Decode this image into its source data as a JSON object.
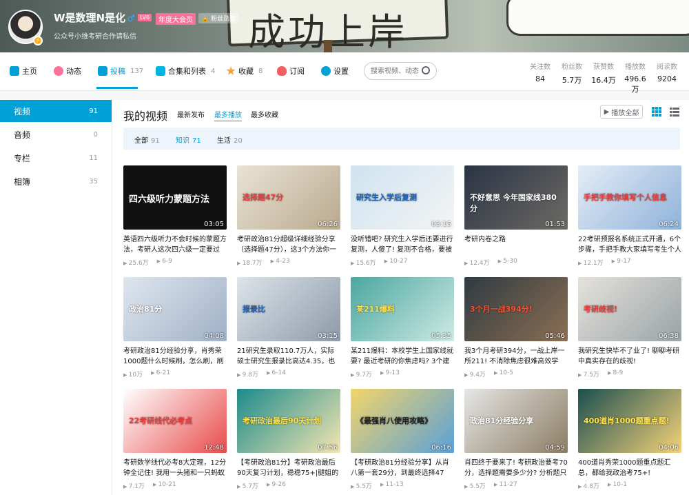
{
  "profile": {
    "username": "W是数理N是化",
    "gender_symbol": "♂",
    "level": "LV6",
    "vip_label": "年度大会员",
    "medal_label": "粉丝勋章",
    "signature": "公众号小维考研合作请私信",
    "banner_text": "成功上岸"
  },
  "nav": {
    "items": [
      {
        "label": "主页",
        "count": ""
      },
      {
        "label": "动态",
        "count": ""
      },
      {
        "label": "投稿",
        "count": "137"
      },
      {
        "label": "合集和列表",
        "count": "4"
      },
      {
        "label": "收藏",
        "count": "8"
      },
      {
        "label": "订阅",
        "count": ""
      },
      {
        "label": "设置",
        "count": ""
      }
    ],
    "search_placeholder": "搜索视频、动态"
  },
  "stats": [
    {
      "label": "关注数",
      "value": "84"
    },
    {
      "label": "粉丝数",
      "value": "5.7万"
    },
    {
      "label": "获赞数",
      "value": "16.4万"
    },
    {
      "label": "播放数",
      "value": "496.6万"
    },
    {
      "label": "阅读数",
      "value": "9204"
    }
  ],
  "sidebar": [
    {
      "label": "视频",
      "count": "91"
    },
    {
      "label": "音频",
      "count": "0"
    },
    {
      "label": "专栏",
      "count": "11"
    },
    {
      "label": "相簿",
      "count": "35"
    }
  ],
  "main": {
    "title": "我的视频",
    "sort_tabs": [
      "最新发布",
      "最多播放",
      "最多收藏"
    ],
    "play_all": "播放全部",
    "filters": [
      {
        "label": "全部",
        "count": "91"
      },
      {
        "label": "知识",
        "count": "71"
      },
      {
        "label": "生活",
        "count": "20"
      }
    ]
  },
  "videos": [
    {
      "title": "英语四六级听力不会时候的蒙题方法，考研人这次四六级一定要过",
      "duration": "03:05",
      "plays": "25.6万",
      "date": "6-9",
      "thumb_text": "四六级听力蒙题方法"
    },
    {
      "title": "考研政治81分超级详细经验分享（选择题47分），这3个方法你一定",
      "duration": "06:26",
      "plays": "18.7万",
      "date": "4-23",
      "thumb_text": "选择题47分"
    },
    {
      "title": "没听错吧? 研究生入学后还要进行复测，人傻了! 复测不合格，要被",
      "duration": "03:15",
      "plays": "15.6万",
      "date": "10-27",
      "thumb_text": "研究生入学后复测"
    },
    {
      "title": "考研内卷之路",
      "duration": "01:53",
      "plays": "12.4万",
      "date": "5-30",
      "thumb_text": "不好意思 今年国家线380分"
    },
    {
      "title": "22考研预报名系统正式开通，6个步骤，手把手教大家填写考生个人部",
      "duration": "06:24",
      "plays": "12.1万",
      "date": "9-17",
      "thumb_text": "手把手教你填写个人信息"
    },
    {
      "title": "考研政治81分经验分享，肖秀荣1000题什么时候刷，怎么刷，刷几",
      "duration": "04:08",
      "plays": "10万",
      "date": "6-21",
      "thumb_text": "政治81分"
    },
    {
      "title": "21研究生录取110.7万人，实际硕士研究生报录比高达4.35，也就是说",
      "duration": "03:15",
      "plays": "9.8万",
      "date": "6-14",
      "thumb_text": "报录比"
    },
    {
      "title": "某211爆料：本校学生上国家线就要? 最近考研的你焦虑吗? 3个建议",
      "duration": "05:35",
      "plays": "9.7万",
      "date": "9-13",
      "thumb_text": "某211爆料"
    },
    {
      "title": "我3个月考研394分，一战上岸一所211! 不消除焦虑很难高效学习，称",
      "duration": "05:46",
      "plays": "9.4万",
      "date": "10-5",
      "thumb_text": "3个月一战394分!"
    },
    {
      "title": "我研究生快毕不了业了! 聊聊考研中真实存在的歧视!",
      "duration": "06:38",
      "plays": "7.5万",
      "date": "8-9",
      "thumb_text": "考研歧视!"
    },
    {
      "title": "考研数学线代必考8大定理，12分钟全记住! 我用一头猪和一只蚂蚁讲",
      "duration": "12:48",
      "plays": "7.1万",
      "date": "10-21",
      "thumb_text": "22考研线代必考点"
    },
    {
      "title": "【考研政治81分】考研政治最后90天复习计划，稳稳75+|腿姐的技巧",
      "duration": "07:56",
      "plays": "5.7万",
      "date": "9-26",
      "thumb_text": "考研政治最后90天计划"
    },
    {
      "title": "【考研政治81分经验分享】从肖八第一套29分，到最终选择47分，我",
      "duration": "06:16",
      "plays": "5.5万",
      "date": "11-13",
      "thumb_text": "《最强肖八使用攻略》"
    },
    {
      "title": "肖四终于要来了! 考研政治要考70分，选择题需要多少分? 分析题只",
      "duration": "04:59",
      "plays": "5.5万",
      "date": "11-27",
      "thumb_text": "政治81分经验分享"
    },
    {
      "title": "400道肖秀荣1000题重点题汇总，都给我政治考75+!",
      "duration": "04:06",
      "plays": "4.8万",
      "date": "10-1",
      "thumb_text": "400道肖1000题重点题!"
    }
  ]
}
